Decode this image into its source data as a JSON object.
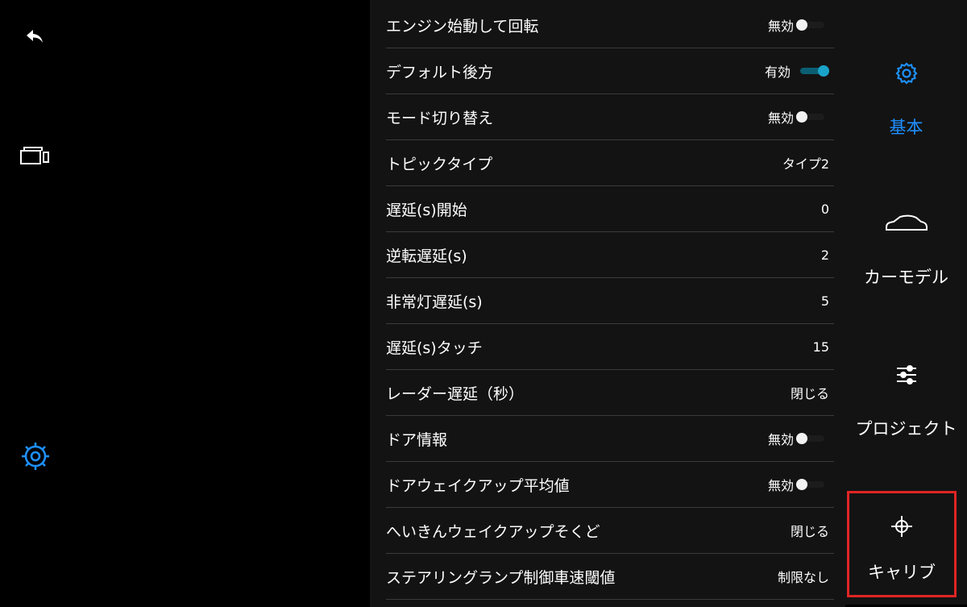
{
  "left_rail": {
    "back_icon": "back-arrow-icon",
    "camera_icon": "camera-icon",
    "settings_icon": "settings-gear-icon"
  },
  "rows": [
    {
      "label": "エンジン始動して回転",
      "type": "toggle",
      "state": "無効",
      "on": false
    },
    {
      "label": "デフォルト後方",
      "type": "toggle",
      "state": "有効",
      "on": true
    },
    {
      "label": "モード切り替え",
      "type": "toggle",
      "state": "無効",
      "on": false
    },
    {
      "label": "トピックタイプ",
      "type": "value",
      "value": "タイプ2"
    },
    {
      "label": "遅延(s)開始",
      "type": "value",
      "value": "0"
    },
    {
      "label": "逆転遅延(s)",
      "type": "value",
      "value": "2"
    },
    {
      "label": "非常灯遅延(s)",
      "type": "value",
      "value": "5"
    },
    {
      "label": "遅延(s)タッチ",
      "type": "value",
      "value": "15"
    },
    {
      "label": "レーダー遅延（秒）",
      "type": "value",
      "value": "閉じる"
    },
    {
      "label": "ドア情報",
      "type": "toggle",
      "state": "無効",
      "on": false
    },
    {
      "label": "ドアウェイクアップ平均値",
      "type": "toggle",
      "state": "無効",
      "on": false
    },
    {
      "label": "へいきんウェイクアップそくど",
      "type": "value",
      "value": "閉じる"
    },
    {
      "label": "ステアリングランプ制御車速閾値",
      "type": "value",
      "value": "制限なし"
    }
  ],
  "right_nav": [
    {
      "label": "基本",
      "icon": "gear-icon",
      "active": true
    },
    {
      "label": "カーモデル",
      "icon": "car-icon",
      "active": false
    },
    {
      "label": "プロジェクト",
      "icon": "sliders-icon",
      "active": false
    },
    {
      "label": "キャリブ",
      "icon": "crosshair-icon",
      "active": false,
      "selected": true
    }
  ],
  "colors": {
    "accent": "#1e90ff",
    "toggle_on": "#1aa3c8",
    "selection_border": "#e02424"
  }
}
